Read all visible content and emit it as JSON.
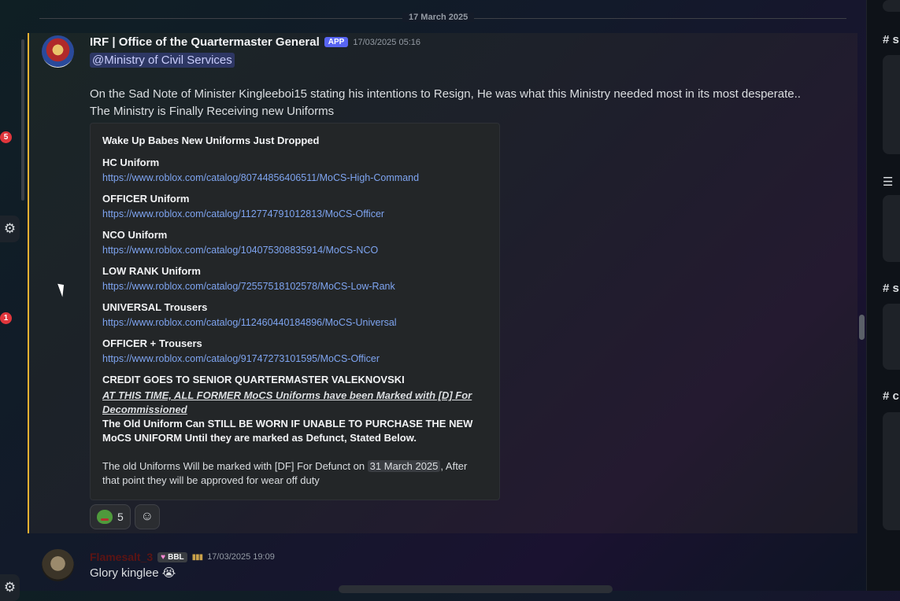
{
  "date_divider": "17 March 2025",
  "rail": {
    "badge_1": "5",
    "badge_2": "1"
  },
  "message_1": {
    "author": "IRF | Office of the Quartermaster General",
    "tag": "APP",
    "timestamp": "17/03/2025 05:16",
    "mention": "@Ministry of Civil Services",
    "line_1": "On the Sad Note of Minister Kingleeboi15 stating his intentions to Resign, He was what this Ministry needed most in its most desperate..",
    "line_2": "The Ministry is Finally Receiving new Uniforms",
    "embed": {
      "title": "Wake Up Babes New Uniforms Just Dropped",
      "items": [
        {
          "label": "HC Uniform",
          "url": "https://www.roblox.com/catalog/80744856406511/MoCS-High-Command"
        },
        {
          "label": "OFFICER Uniform",
          "url": "https://www.roblox.com/catalog/112774791012813/MoCS-Officer"
        },
        {
          "label": "NCO Uniform",
          "url": "https://www.roblox.com/catalog/104075308835914/MoCS-NCO"
        },
        {
          "label": "LOW RANK Uniform",
          "url": "https://www.roblox.com/catalog/72557518102578/MoCS-Low-Rank"
        },
        {
          "label": "UNIVERSAL Trousers",
          "url": "https://www.roblox.com/catalog/112460440184896/MoCS-Universal"
        },
        {
          "label": "OFFICER + Trousers",
          "url": "https://www.roblox.com/catalog/91747273101595/MoCS-Officer"
        }
      ],
      "credit": "CREDIT GOES TO SENIOR QUARTERMASTER VALEKNOVSKI",
      "notice_1": "AT THIS TIME, ALL FORMER MoCS Uniforms have been Marked with [D] For",
      "notice_2": "Decommissioned",
      "old_1": "The Old Uniform Can STILL BE WORN IF UNABLE TO PURCHASE THE NEW",
      "old_2": "MoCS UNIFORM Until they are marked as Defunct, Stated Below.",
      "footer_pre": "The old Uniforms Will be marked with [DF] For Defunct on ",
      "footer_date": "31 March 2025",
      "footer_post": ", After",
      "footer_2": "that point they will be approved for wear off duty"
    },
    "reactions": [
      {
        "emoji": "pepe-cry",
        "count": "5"
      }
    ]
  },
  "message_2": {
    "author": "Flamesalt_3",
    "tag": "BBL",
    "timestamp": "17/03/2025 19:09",
    "text": "Glory kinglee",
    "emoji": "😭"
  },
  "right_panel": {
    "hash_1": "# s",
    "hash_2": "# s",
    "hash_3": "# c"
  },
  "colors": {
    "accent": "#5865f2",
    "link": "#7ea4f0",
    "highlight": "#f0b132",
    "badge": "#e0363c"
  }
}
